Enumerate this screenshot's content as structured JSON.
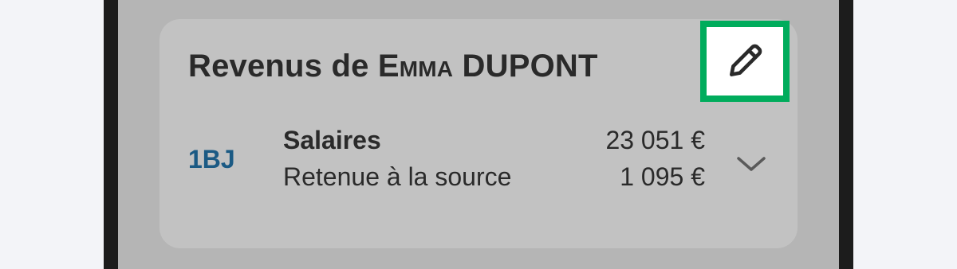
{
  "card": {
    "title_prefix": "Revenus de ",
    "first_name": "Emma",
    "last_name": " DUPONT",
    "edit_icon": "pencil-icon"
  },
  "income_row": {
    "code": "1BJ",
    "label": "Salaires",
    "sub_label": "Retenue à la source",
    "amount": "23 051 €",
    "sub_amount": "1 095 €",
    "expand_icon": "chevron-down-icon"
  },
  "colors": {
    "accent_border": "#00ac5c",
    "code_color": "#1b5a84"
  }
}
